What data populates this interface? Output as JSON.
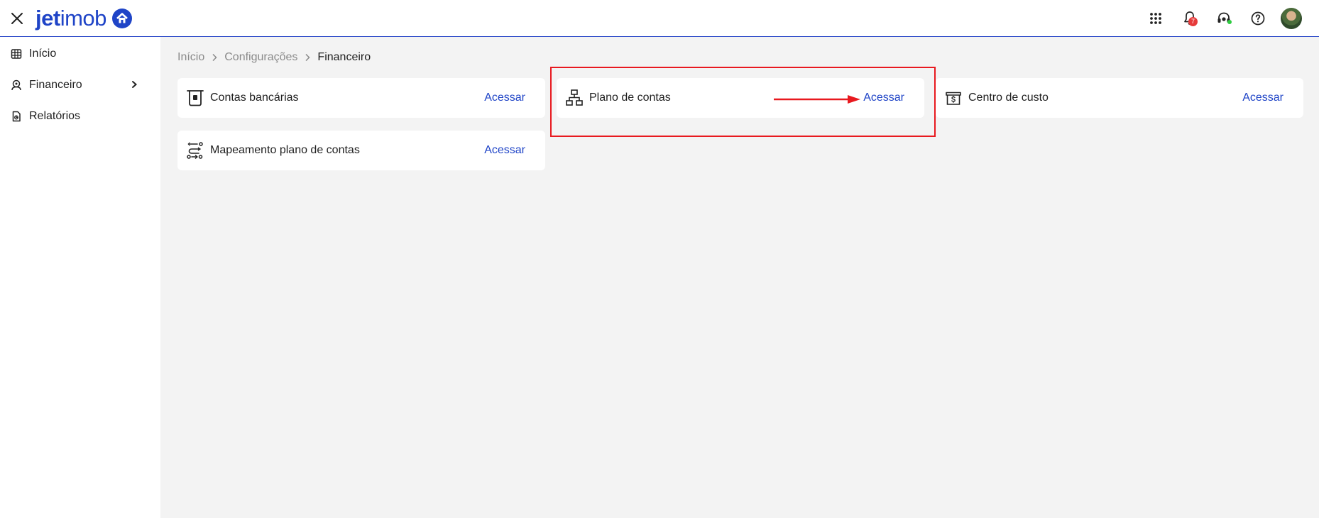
{
  "header": {
    "logo": {
      "bold": "jet",
      "light": "imob"
    },
    "notifications_count": "7"
  },
  "sidebar": {
    "items": [
      {
        "label": "Início",
        "icon": "table-grid-icon"
      },
      {
        "label": "Financeiro",
        "icon": "finance-person-icon",
        "has_submenu": true
      },
      {
        "label": "Relatórios",
        "icon": "report-file-icon"
      }
    ]
  },
  "breadcrumb": [
    "Início",
    "Configurações",
    "Financeiro"
  ],
  "cards": [
    {
      "title": "Contas bancárias",
      "link": "Acessar",
      "icon": "atm-icon"
    },
    {
      "title": "Plano de contas",
      "link": "Acessar",
      "icon": "sitemap-icon"
    },
    {
      "title": "Centro de custo",
      "link": "Acessar",
      "icon": "cost-center-box-icon"
    },
    {
      "title": "Mapeamento plano de contas",
      "link": "Acessar",
      "icon": "route-mapping-icon"
    }
  ],
  "colors": {
    "accent": "#1f44c7",
    "annotation": "#e8191f",
    "badge": "#e63a3a"
  }
}
